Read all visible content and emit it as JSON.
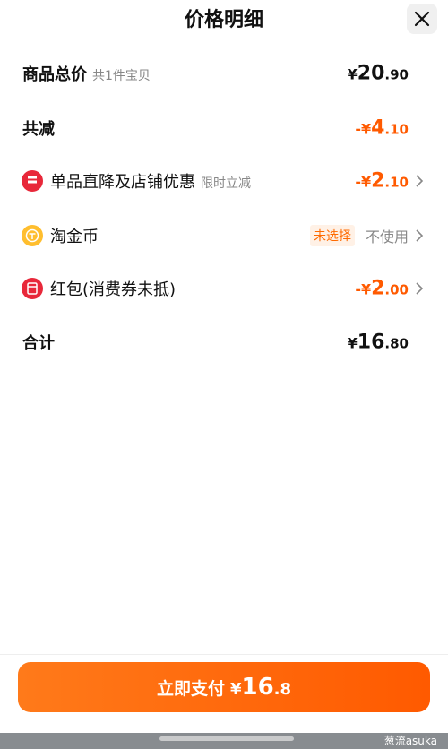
{
  "header": {
    "title": "价格明细"
  },
  "rows": {
    "subtotal": {
      "label": "商品总价",
      "sub": "共1件宝贝",
      "currency": "¥",
      "int": "20",
      "dec": ".90"
    },
    "discount": {
      "label": "共减",
      "currency": "-¥",
      "int": "4",
      "dec": ".10"
    },
    "promo": {
      "label": "单品直降及店铺优惠",
      "sub": "限时立减",
      "currency": "-¥",
      "int": "2",
      "dec": ".10"
    },
    "coins": {
      "label": "淘金币",
      "tag": "未选择",
      "right": "不使用"
    },
    "redpacket": {
      "label": "红包(消费券未抵)",
      "currency": "-¥",
      "int": "2",
      "dec": ".00"
    },
    "total": {
      "label": "合计",
      "currency": "¥",
      "int": "16",
      "dec": ".80"
    }
  },
  "footer": {
    "pay_label": "立即支付",
    "currency": "¥",
    "int": "16",
    "dec": ".8"
  },
  "bottom": {
    "watermark": "葱流asuka"
  },
  "colors": {
    "accent": "#ff5a00",
    "red_icon": "#e8283a",
    "coin_icon": "#ffbe2e"
  }
}
